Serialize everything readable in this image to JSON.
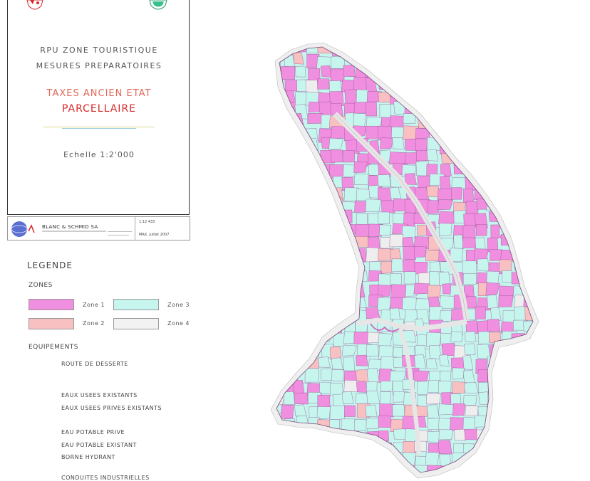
{
  "title_block": {
    "line1": "RPU ZONE TOURISTIQUE",
    "line2": "MESURES PREPARATOIRES",
    "line3": "TAXES ANCIEN ETAT",
    "line4": "PARCELLAIRE",
    "scale": "Echelle 1:2'000"
  },
  "cartouche": {
    "company": "BLANC & SCHMID SA",
    "ref": "1:12 433",
    "date": "MAX, juillet 2007"
  },
  "legend": {
    "title": "LEGENDE",
    "zones_title": "ZONES",
    "zones": [
      {
        "label": "Zone 1",
        "color": "#f08ee0"
      },
      {
        "label": "Zone 2",
        "color": "#f8c0c0"
      },
      {
        "label": "Zone 3",
        "color": "#c6f5ee"
      },
      {
        "label": "Zone 4",
        "color": "#f2f2f2"
      }
    ],
    "equipements_title": "EQUIPEMENTS",
    "equipements": [
      "ROUTE DE DESSERTE",
      "EAUX USEES EXISTANTS",
      "EAUX USEES PRIVES EXISTANTS",
      "EAU POTABLE PRIVE",
      "EAU POTABLE EXISTANT",
      "BORNE HYDRANT",
      "CONDUITES INDUSTRIELLES"
    ]
  },
  "map": {
    "colors": {
      "zone1": "#f08ee0",
      "zone2": "#f8c0c0",
      "zone3": "#c6f5ee",
      "zone4": "#eeeeee",
      "road": "#d9d9d9"
    }
  }
}
